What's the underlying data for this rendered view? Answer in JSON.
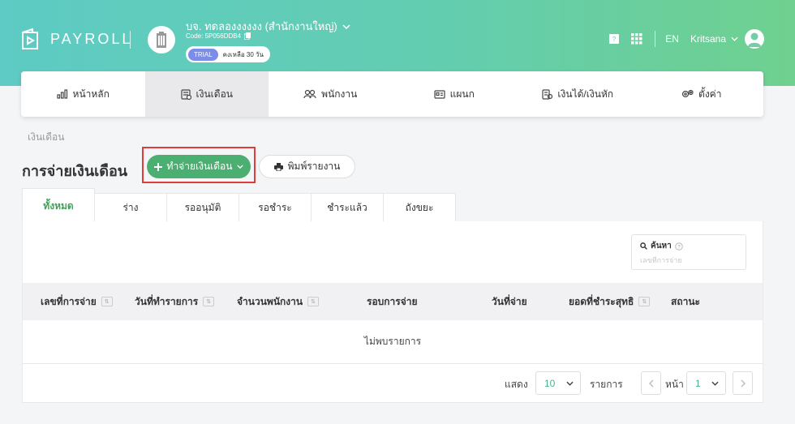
{
  "header": {
    "logo_text": "PAYROLL",
    "company_name": "บจ. ทดลองงงงงง (สำนักงานใหญ่)",
    "company_code": "Code: 5P056DDB4",
    "trial_label": "TRIAL",
    "trial_remaining": "คงเหลือ 30 วัน",
    "language": "EN",
    "user_name": "Kritsana"
  },
  "main_nav": [
    {
      "label": "หน้าหลัก",
      "icon": "chart-icon"
    },
    {
      "label": "เงินเดือน",
      "icon": "payroll-icon",
      "active": true
    },
    {
      "label": "พนักงาน",
      "icon": "employees-icon"
    },
    {
      "label": "แผนก",
      "icon": "department-icon"
    },
    {
      "label": "เงินได้/เงินหัก",
      "icon": "income-deduction-icon"
    },
    {
      "label": "ตั้งค่า",
      "icon": "settings-icon"
    }
  ],
  "breadcrumb": "เงินเดือน",
  "page_title": "การจ่ายเงินเดือน",
  "actions": {
    "create_label": "ทำจ่ายเงินเดือน",
    "print_label": "พิมพ์รายงาน"
  },
  "tabs": [
    "ทั้งหมด",
    "ร่าง",
    "รออนุมัติ",
    "รอชำระ",
    "ชำระแล้ว",
    "ถังขยะ"
  ],
  "search": {
    "label": "ค้นหา",
    "placeholder": "เลขที่การจ่าย"
  },
  "table": {
    "columns": [
      "เลขที่การจ่าย",
      "วันที่ทำรายการ",
      "จำนวนพนักงาน",
      "รอบการจ่าย",
      "วันที่จ่าย",
      "ยอดที่ชำระสุทธิ",
      "สถานะ"
    ],
    "empty_text": "ไม่พบรายการ"
  },
  "pagination": {
    "show_label": "แสดง",
    "page_size": "10",
    "items_label": "รายการ",
    "page_label": "หน้า",
    "current_page": "1"
  },
  "colors": {
    "primary": "#4caf72",
    "highlight": "#e23b3b"
  }
}
